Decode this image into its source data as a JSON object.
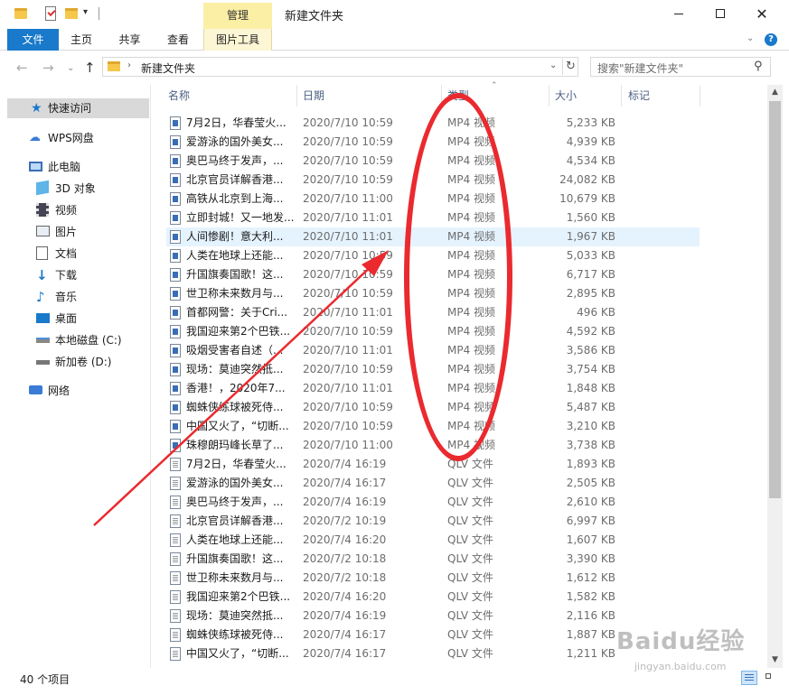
{
  "titlebar": {
    "manage_tab": "管理",
    "title": "新建文件夹",
    "minimize_glyph": "—",
    "close_glyph": "✕"
  },
  "ribbon": {
    "tabs": [
      "文件",
      "主页",
      "共享",
      "查看",
      "图片工具"
    ],
    "accent_color": "#1979ca",
    "context_tab_color": "#fbeea5"
  },
  "address": {
    "path": "新建文件夹",
    "search_placeholder": "搜索\"新建文件夹\""
  },
  "navpane": {
    "items": [
      {
        "label": "快速访问",
        "icon": "star-icon"
      },
      {
        "label": "WPS网盘",
        "icon": "cloud-icon"
      },
      {
        "label": "此电脑",
        "icon": "computer-icon"
      },
      {
        "label": "3D 对象",
        "icon": "cube-icon"
      },
      {
        "label": "视频",
        "icon": "film-icon"
      },
      {
        "label": "图片",
        "icon": "picture-icon"
      },
      {
        "label": "文档",
        "icon": "document-icon"
      },
      {
        "label": "下载",
        "icon": "download-arrow-icon"
      },
      {
        "label": "音乐",
        "icon": "music-note-icon"
      },
      {
        "label": "桌面",
        "icon": "desktop-icon"
      },
      {
        "label": "本地磁盘 (C:)",
        "icon": "drive-c-icon"
      },
      {
        "label": "新加卷 (D:)",
        "icon": "drive-icon"
      },
      {
        "label": "网络",
        "icon": "network-icon"
      }
    ]
  },
  "columns": [
    "名称",
    "日期",
    "类型",
    "大小",
    "标记"
  ],
  "files": [
    {
      "name": "7月2日，华春莹火...",
      "date": "2020/7/10 10:59",
      "type": "MP4 视频",
      "size": "5,233 KB"
    },
    {
      "name": "爱游泳的国外美女...",
      "date": "2020/7/10 10:59",
      "type": "MP4 视频",
      "size": "4,939 KB"
    },
    {
      "name": "奥巴马终于发声，...",
      "date": "2020/7/10 10:59",
      "type": "MP4 视频",
      "size": "4,534 KB"
    },
    {
      "name": "北京官员详解香港...",
      "date": "2020/7/10 10:59",
      "type": "MP4 视频",
      "size": "24,082 KB"
    },
    {
      "name": "高铁从北京到上海...",
      "date": "2020/7/10 11:00",
      "type": "MP4 视频",
      "size": "10,679 KB"
    },
    {
      "name": "立即封城！又一地发...",
      "date": "2020/7/10 11:01",
      "type": "MP4 视频",
      "size": "1,560 KB"
    },
    {
      "name": "人间惨剧！意大利...",
      "date": "2020/7/10 11:01",
      "type": "MP4 视频",
      "size": "1,967 KB"
    },
    {
      "name": "人类在地球上还能...",
      "date": "2020/7/10 10:59",
      "type": "MP4 视频",
      "size": "5,033 KB"
    },
    {
      "name": "升国旗奏国歌！这...",
      "date": "2020/7/10 10:59",
      "type": "MP4 视频",
      "size": "6,717 KB"
    },
    {
      "name": "世卫称未来数月与...",
      "date": "2020/7/10 10:59",
      "type": "MP4 视频",
      "size": "2,895 KB"
    },
    {
      "name": "首都网警：关于Cri...",
      "date": "2020/7/10 11:01",
      "type": "MP4 视频",
      "size": "496 KB"
    },
    {
      "name": "我国迎来第2个巴铁...",
      "date": "2020/7/10 10:59",
      "type": "MP4 视频",
      "size": "4,592 KB"
    },
    {
      "name": "吸烟受害者自述（...",
      "date": "2020/7/10 11:01",
      "type": "MP4 视频",
      "size": "3,586 KB"
    },
    {
      "name": "现场：莫迪突然抵...",
      "date": "2020/7/10 10:59",
      "type": "MP4 视频",
      "size": "3,754 KB"
    },
    {
      "name": "香港！，2020年7...",
      "date": "2020/7/10 11:01",
      "type": "MP4 视频",
      "size": "1,848 KB"
    },
    {
      "name": "蜘蛛侠练球被死侍...",
      "date": "2020/7/10 10:59",
      "type": "MP4 视频",
      "size": "5,487 KB"
    },
    {
      "name": "中国又火了，“切断...",
      "date": "2020/7/10 10:59",
      "type": "MP4 视频",
      "size": "3,210 KB"
    },
    {
      "name": "珠穆朗玛峰长草了...",
      "date": "2020/7/10 11:00",
      "type": "MP4 视频",
      "size": "3,738 KB"
    },
    {
      "name": "7月2日，华春莹火...",
      "date": "2020/7/4 16:19",
      "type": "QLV 文件",
      "size": "1,893 KB"
    },
    {
      "name": "爱游泳的国外美女...",
      "date": "2020/7/4 16:17",
      "type": "QLV 文件",
      "size": "2,505 KB"
    },
    {
      "name": "奥巴马终于发声，...",
      "date": "2020/7/4 16:19",
      "type": "QLV 文件",
      "size": "2,610 KB"
    },
    {
      "name": "北京官员详解香港...",
      "date": "2020/7/2 10:19",
      "type": "QLV 文件",
      "size": "6,997 KB"
    },
    {
      "name": "人类在地球上还能...",
      "date": "2020/7/4 16:20",
      "type": "QLV 文件",
      "size": "1,607 KB"
    },
    {
      "name": "升国旗奏国歌！这...",
      "date": "2020/7/2 10:18",
      "type": "QLV 文件",
      "size": "3,390 KB"
    },
    {
      "name": "世卫称未来数月与...",
      "date": "2020/7/2 10:18",
      "type": "QLV 文件",
      "size": "1,612 KB"
    },
    {
      "name": "我国迎来第2个巴铁...",
      "date": "2020/7/4 16:20",
      "type": "QLV 文件",
      "size": "1,582 KB"
    },
    {
      "name": "现场：莫迪突然抵...",
      "date": "2020/7/4 16:19",
      "type": "QLV 文件",
      "size": "2,116 KB"
    },
    {
      "name": "蜘蛛侠练球被死侍...",
      "date": "2020/7/4 16:17",
      "type": "QLV 文件",
      "size": "1,887 KB"
    },
    {
      "name": "中国又火了，“切断...",
      "date": "2020/7/4 16:17",
      "type": "QLV 文件",
      "size": "1,211 KB"
    }
  ],
  "selected_row": 6,
  "status": {
    "item_count": "40 个项目"
  },
  "annotation": {
    "color": "#ea2a2f"
  },
  "watermark": {
    "logo": "Baidu经验",
    "sub": "jingyan.baidu.com"
  }
}
